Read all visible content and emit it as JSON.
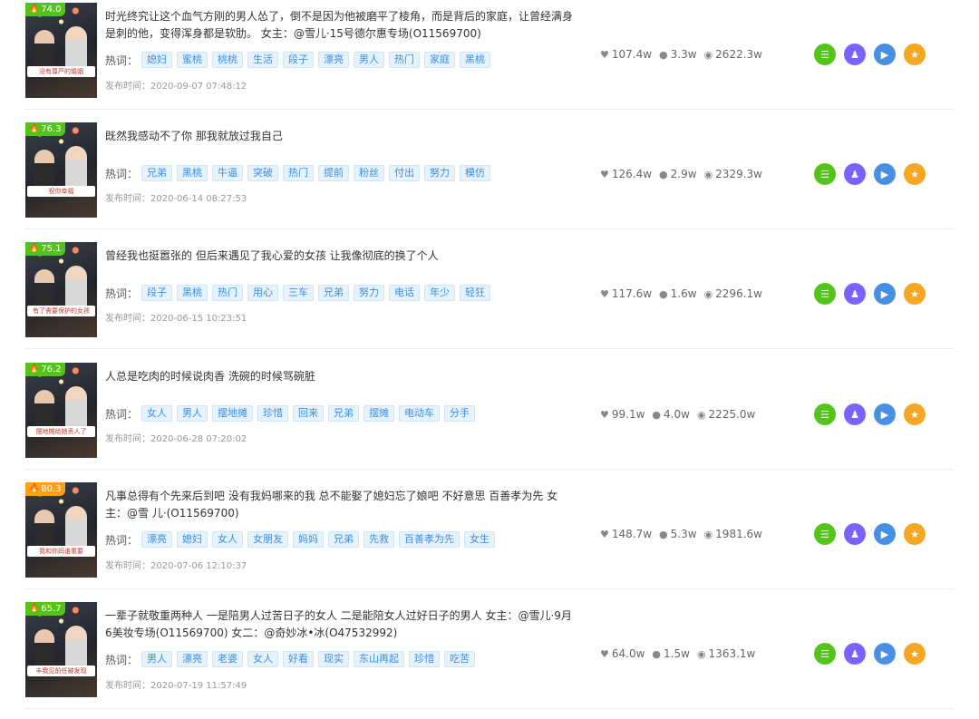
{
  "labels": {
    "hot_words": "热词：",
    "publish_time": "发布时间："
  },
  "colors": {
    "score_green": "#52c41a",
    "score_orange": "#ff9f1a",
    "tag_bg": "#e6f3fd",
    "tag_text": "#3a8ee6"
  },
  "action_icons": [
    "list-icon",
    "users-icon",
    "play-icon",
    "star-icon"
  ],
  "rows": [
    {
      "score": "74.0",
      "title": "时光终究让这个血气方刚的男人怂了，倒不是因为他被磨平了棱角，而是背后的家庭，让曾经满身是刺的他，变得浑身都是软肋。 女主：@雪儿·15号德尔惠专场(O11569700)",
      "tags": [
        "媳妇",
        "蜜桃",
        "桃桃",
        "生活",
        "段子",
        "漂亮",
        "男人",
        "热门",
        "家庭",
        "黑桃"
      ],
      "time": "2020-09-07 07:48:12",
      "likes": "107.4w",
      "comments": "3.3w",
      "views": "2622.3w",
      "banner": "没有尊严的婚姻"
    },
    {
      "score": "76.3",
      "title": "既然我感动不了你 那我就放过我自己",
      "tags": [
        "兄弟",
        "黑桃",
        "牛逼",
        "突破",
        "热门",
        "提前",
        "粉丝",
        "付出",
        "努力",
        "模仿"
      ],
      "time": "2020-06-14 08:27:53",
      "likes": "126.4w",
      "comments": "2.9w",
      "views": "2329.3w",
      "banner": "祝你幸福"
    },
    {
      "score": "75.1",
      "title": "曾经我也挺嚣张的 但后来遇见了我心爱的女孩 让我像彻底的换了个人",
      "tags": [
        "段子",
        "黑桃",
        "热门",
        "用心",
        "三车",
        "兄弟",
        "努力",
        "电话",
        "年少",
        "轻狂"
      ],
      "time": "2020-06-15 10:23:51",
      "likes": "117.6w",
      "comments": "1.6w",
      "views": "2296.1w",
      "banner": "有了需要保护的女孩"
    },
    {
      "score": "76.2",
      "title": "人总是吃肉的时候说肉香 洗碗的时候骂碗脏",
      "tags": [
        "女人",
        "男人",
        "摆地摊",
        "珍惜",
        "回来",
        "兄弟",
        "摆摊",
        "电动车",
        "分手"
      ],
      "time": "2020-06-28 07:20:02",
      "likes": "99.1w",
      "comments": "4.0w",
      "views": "2225.0w",
      "banner": "摆地摊给她丢人了"
    },
    {
      "score": "80.3",
      "title": "凡事总得有个先来后到吧 没有我妈哪来的我 总不能娶了媳妇忘了娘吧 不好意思 百善孝为先  女主：@雪 儿·(O11569700)",
      "tags": [
        "漂亮",
        "媳妇",
        "女人",
        "女朋友",
        "妈妈",
        "兄弟",
        "先救",
        "百善孝为先",
        "女生"
      ],
      "time": "2020-07-06 12:10:37",
      "likes": "148.7w",
      "comments": "5.3w",
      "views": "1981.6w",
      "banner": "我和你妈谁重要"
    },
    {
      "score": "65.7",
      "title": "一辈子就敬重两种人 一是陪男人过苦日子的女人 二是能陪女人过好日子的男人 女主：@雪儿·9月6美妆专场(O11569700) 女二：@奇妙冰•冰(O47532992)",
      "tags": [
        "男人",
        "漂亮",
        "老婆",
        "女人",
        "好看",
        "现实",
        "东山再起",
        "珍惜",
        "吃苦"
      ],
      "time": "2020-07-19 11:57:49",
      "likes": "64.0w",
      "comments": "1.5w",
      "views": "1363.1w",
      "banner": "丰我见前任被发现"
    }
  ]
}
